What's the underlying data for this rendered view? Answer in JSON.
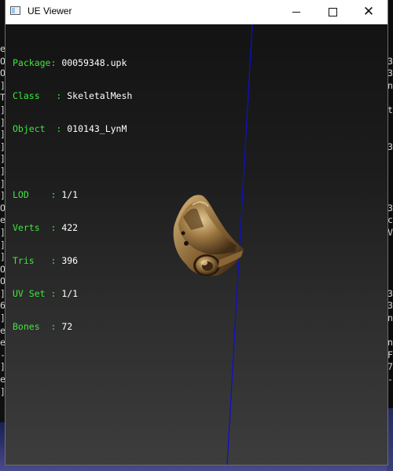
{
  "window": {
    "title": "UE Viewer"
  },
  "info": {
    "package_label": "Package: ",
    "package": "00059348.upk",
    "class_label": "Class   : ",
    "class": "SkeletalMesh",
    "object_label": "Object  : ",
    "object": "010143_LynM",
    "lod_label": "LOD    : ",
    "lod": "1/1",
    "verts_label": "Verts  : ",
    "verts": "422",
    "tris_label": "Tris   : ",
    "tris": "396",
    "uvset_label": "UV Set : ",
    "uvset": "1/1",
    "bones_label": "Bones  : ",
    "bones": "72"
  },
  "background_console": {
    "left": [
      "e",
      "O",
      "O",
      "]",
      "T",
      "]",
      "]",
      "]",
      "]",
      "]",
      "]",
      "]",
      "]",
      "O",
      "e",
      "]",
      "]",
      "]",
      "O",
      "O",
      "]",
      "6",
      "]",
      "e",
      "e",
      "-",
      "]",
      "e",
      "]"
    ],
    "right": [
      "",
      "3",
      "3",
      "n",
      "",
      "t",
      "",
      "",
      "3",
      "",
      "",
      "",
      "",
      "3",
      "c",
      "V",
      "",
      "",
      "",
      "",
      "3",
      "3",
      "n",
      "",
      "n",
      "F",
      "7",
      "-",
      "",
      ""
    ]
  },
  "colors": {
    "label_green": "#3ee63e",
    "axis_blue": "#1010c8",
    "mesh_bronze": "#a07a44"
  },
  "icons": [
    "app-icon",
    "minimize-icon",
    "maximize-icon",
    "close-icon"
  ]
}
